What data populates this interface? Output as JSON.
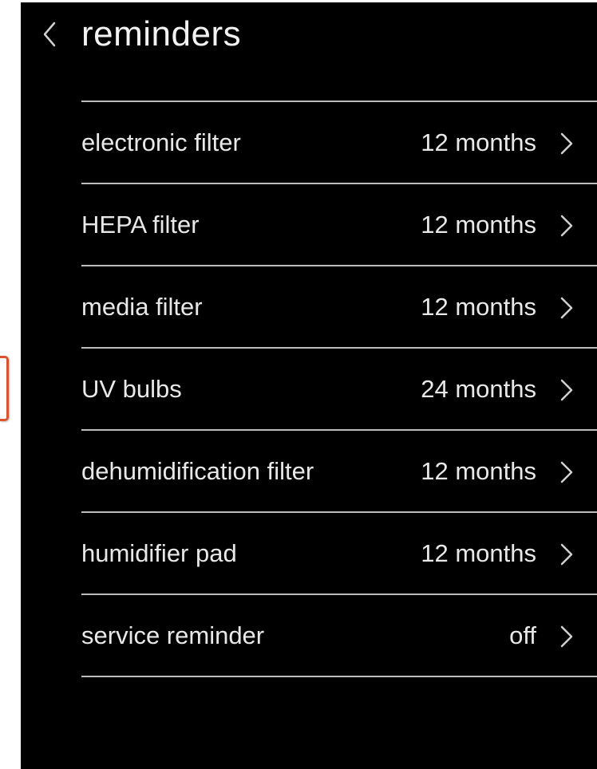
{
  "header": {
    "back_icon": "chevron-left-icon",
    "title": "reminders"
  },
  "reminders": [
    {
      "label": "electronic filter",
      "value": "12 months",
      "icon": "chevron-right-icon"
    },
    {
      "label": "HEPA filter",
      "value": "12 months",
      "icon": "chevron-right-icon"
    },
    {
      "label": "media filter",
      "value": "12 months",
      "icon": "chevron-right-icon"
    },
    {
      "label": "UV bulbs",
      "value": "24 months",
      "icon": "chevron-right-icon"
    },
    {
      "label": "dehumidification filter",
      "value": "12 months",
      "icon": "chevron-right-icon"
    },
    {
      "label": "humidifier pad",
      "value": "12 months",
      "icon": "chevron-right-icon"
    },
    {
      "label": "service reminder",
      "value": "off",
      "icon": "chevron-right-icon"
    }
  ],
  "colors": {
    "background": "#000000",
    "text": "#e8e8e8",
    "divider": "#bdbdbd",
    "side_tab_accent": "#d9532f"
  }
}
